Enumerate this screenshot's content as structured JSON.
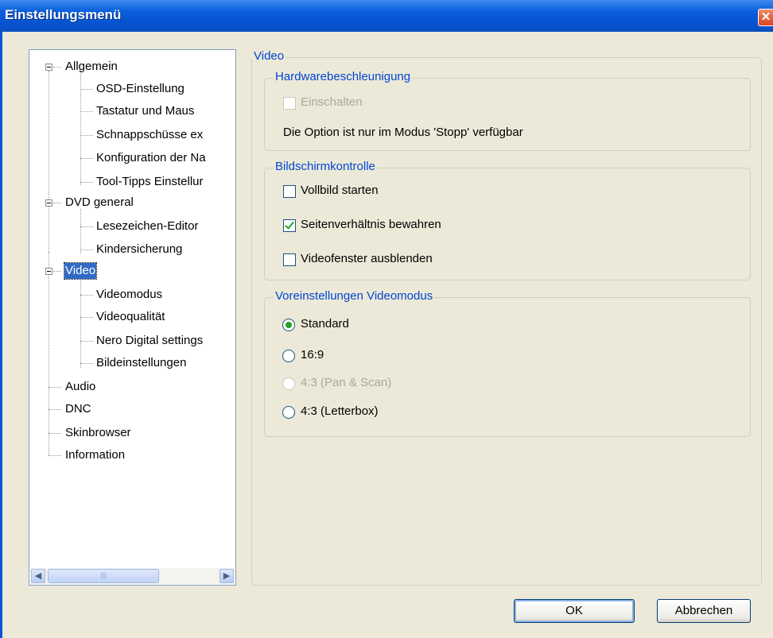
{
  "window": {
    "title": "Einstellungsmenü",
    "close_symbol": "✕"
  },
  "tree": {
    "items": [
      {
        "label": "Allgemein"
      },
      {
        "label": "OSD-Einstellung"
      },
      {
        "label": "Tastatur und Maus"
      },
      {
        "label": "Schnappschüsse ex"
      },
      {
        "label": "Konfiguration der Na"
      },
      {
        "label": "Tool-Tipps Einstellur"
      },
      {
        "label": "DVD general"
      },
      {
        "label": "Lesezeichen-Editor"
      },
      {
        "label": "Kindersicherung"
      },
      {
        "label": "Video"
      },
      {
        "label": "Videomodus"
      },
      {
        "label": "Videoqualität"
      },
      {
        "label": "Nero Digital settings"
      },
      {
        "label": "Bildeinstellungen"
      },
      {
        "label": "Audio"
      },
      {
        "label": "DNC"
      },
      {
        "label": "Skinbrowser"
      },
      {
        "label": "Information"
      }
    ],
    "scroll_left": "◀",
    "scroll_right": "▶",
    "scroll_grip": "|||"
  },
  "panel": {
    "title": "Video",
    "hardware": {
      "title": "Hardwarebeschleunigung",
      "enable_label": "Einschalten",
      "note": "Die Option ist nur im Modus 'Stopp' verfügbar"
    },
    "screen": {
      "title": "Bildschirmkontrolle",
      "fullscreen_label": "Vollbild starten",
      "aspect_label": "Seitenverhältnis bewahren",
      "hide_label": "Videofenster ausblenden"
    },
    "presets": {
      "title": "Voreinstellungen Videomodus",
      "standard": "Standard",
      "wide": "16:9",
      "panscan": "4:3 (Pan & Scan)",
      "letterbox": "4:3 (Letterbox)"
    }
  },
  "buttons": {
    "ok": "OK",
    "cancel": "Abbrechen"
  }
}
